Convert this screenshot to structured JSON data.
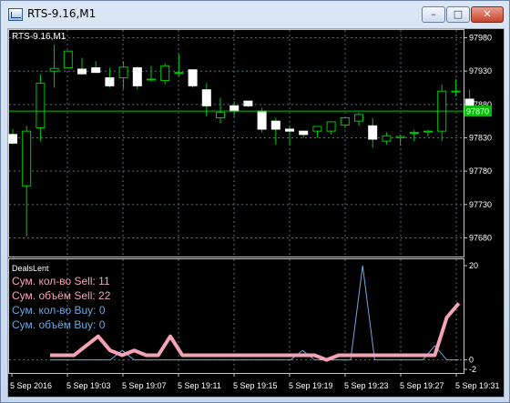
{
  "window": {
    "title": "RTS-9.16,M1",
    "buttons": {
      "minimize": "–",
      "maximize": "□",
      "close": "✕"
    },
    "icon": "chart-window-icon"
  },
  "main_chart": {
    "label": "RTS-9.16,M1",
    "price_axis": [
      "97980",
      "97930",
      "97880",
      "97830",
      "97780",
      "97730",
      "97680"
    ],
    "current_price": "97870",
    "colors": {
      "bull": "#ffffff",
      "bear": "#ffffff",
      "wick": "#00c800",
      "grid": "#5a6e7a",
      "price_line": "#00c800",
      "price_tag": "#00c000"
    }
  },
  "indicator": {
    "name": "DealsLent",
    "lines": [
      {
        "text": "Сум. кол-во Sell: 11",
        "color": "#f4a3b4"
      },
      {
        "text": "Сум. объём Sell: 22",
        "color": "#f4a3b4"
      },
      {
        "text": "Сум. кол-во Buy: 0",
        "color": "#6fa8dc"
      },
      {
        "text": "Сум. объём Buy: 0",
        "color": "#6fa8dc"
      }
    ],
    "scale": [
      "20",
      "0",
      "-2"
    ]
  },
  "time_axis": [
    "5 Sep 2016",
    "5 Sep 19:03",
    "5 Sep 19:07",
    "5 Sep 19:11",
    "5 Sep 19:15",
    "5 Sep 19:19",
    "5 Sep 19:23",
    "5 Sep 19:27",
    "5 Sep 19:31"
  ],
  "chart_data": {
    "type": "candlestick",
    "candles": [
      {
        "o": 97835,
        "h": 97843,
        "l": 97820,
        "c": 97822
      },
      {
        "o": 97758,
        "h": 97848,
        "l": 97682,
        "c": 97840
      },
      {
        "o": 97845,
        "h": 97925,
        "l": 97825,
        "c": 97912
      },
      {
        "o": 97930,
        "h": 97970,
        "l": 97905,
        "c": 97934
      },
      {
        "o": 97935,
        "h": 97958,
        "l": 97938,
        "c": 97960
      },
      {
        "o": 97933,
        "h": 97950,
        "l": 97925,
        "c": 97926
      },
      {
        "o": 97935,
        "h": 97945,
        "l": 97928,
        "c": 97928
      },
      {
        "o": 97920,
        "h": 97935,
        "l": 97905,
        "c": 97908
      },
      {
        "o": 97920,
        "h": 97945,
        "l": 97903,
        "c": 97936
      },
      {
        "o": 97935,
        "h": 97937,
        "l": 97903,
        "c": 97908
      },
      {
        "o": 97918,
        "h": 97938,
        "l": 97915,
        "c": 97918
      },
      {
        "o": 97916,
        "h": 97942,
        "l": 97910,
        "c": 97938
      },
      {
        "o": 97928,
        "h": 97955,
        "l": 97922,
        "c": 97928
      },
      {
        "o": 97932,
        "h": 97932,
        "l": 97905,
        "c": 97908
      },
      {
        "o": 97902,
        "h": 97912,
        "l": 97862,
        "c": 97878
      },
      {
        "o": 97860,
        "h": 97890,
        "l": 97852,
        "c": 97868
      },
      {
        "o": 97878,
        "h": 97885,
        "l": 97860,
        "c": 97870
      },
      {
        "o": 97885,
        "h": 97885,
        "l": 97876,
        "c": 97878
      },
      {
        "o": 97870,
        "h": 97875,
        "l": 97838,
        "c": 97843
      },
      {
        "o": 97855,
        "h": 97860,
        "l": 97820,
        "c": 97843
      },
      {
        "o": 97843,
        "h": 97848,
        "l": 97818,
        "c": 97840
      },
      {
        "o": 97840,
        "h": 97840,
        "l": 97830,
        "c": 97835
      },
      {
        "o": 97840,
        "h": 97845,
        "l": 97830,
        "c": 97847
      },
      {
        "o": 97840,
        "h": 97852,
        "l": 97835,
        "c": 97854
      },
      {
        "o": 97849,
        "h": 97858,
        "l": 97845,
        "c": 97860
      },
      {
        "o": 97855,
        "h": 97868,
        "l": 97848,
        "c": 97865
      },
      {
        "o": 97848,
        "h": 97860,
        "l": 97815,
        "c": 97828
      },
      {
        "o": 97825,
        "h": 97838,
        "l": 97820,
        "c": 97833
      },
      {
        "o": 97830,
        "h": 97835,
        "l": 97818,
        "c": 97832
      },
      {
        "o": 97838,
        "h": 97842,
        "l": 97825,
        "c": 97838
      },
      {
        "o": 97840,
        "h": 97842,
        "l": 97832,
        "c": 97840
      },
      {
        "o": 97840,
        "h": 97910,
        "l": 97825,
        "c": 97900
      },
      {
        "o": 97900,
        "h": 97918,
        "l": 97892,
        "c": 97900
      },
      {
        "o": 97888,
        "h": 97902,
        "l": 97880,
        "c": 97876
      }
    ],
    "sell_volume": [
      1,
      1,
      1,
      3,
      5,
      2,
      1,
      2,
      1,
      1,
      5,
      1,
      1,
      1,
      1,
      1,
      1,
      1,
      1,
      1,
      1,
      1,
      1,
      0,
      1,
      1,
      1,
      1,
      1,
      1,
      1,
      1,
      1,
      9,
      12
    ],
    "buy_volume": [
      0,
      0,
      0,
      0,
      0,
      0,
      2,
      0,
      0,
      0,
      0,
      0,
      0,
      0,
      0,
      0,
      0,
      0,
      0,
      0,
      0,
      2,
      0,
      0,
      0,
      0,
      20,
      0,
      0,
      0,
      0,
      0,
      3,
      0,
      0
    ],
    "indicator_range": [
      -2,
      20
    ]
  }
}
